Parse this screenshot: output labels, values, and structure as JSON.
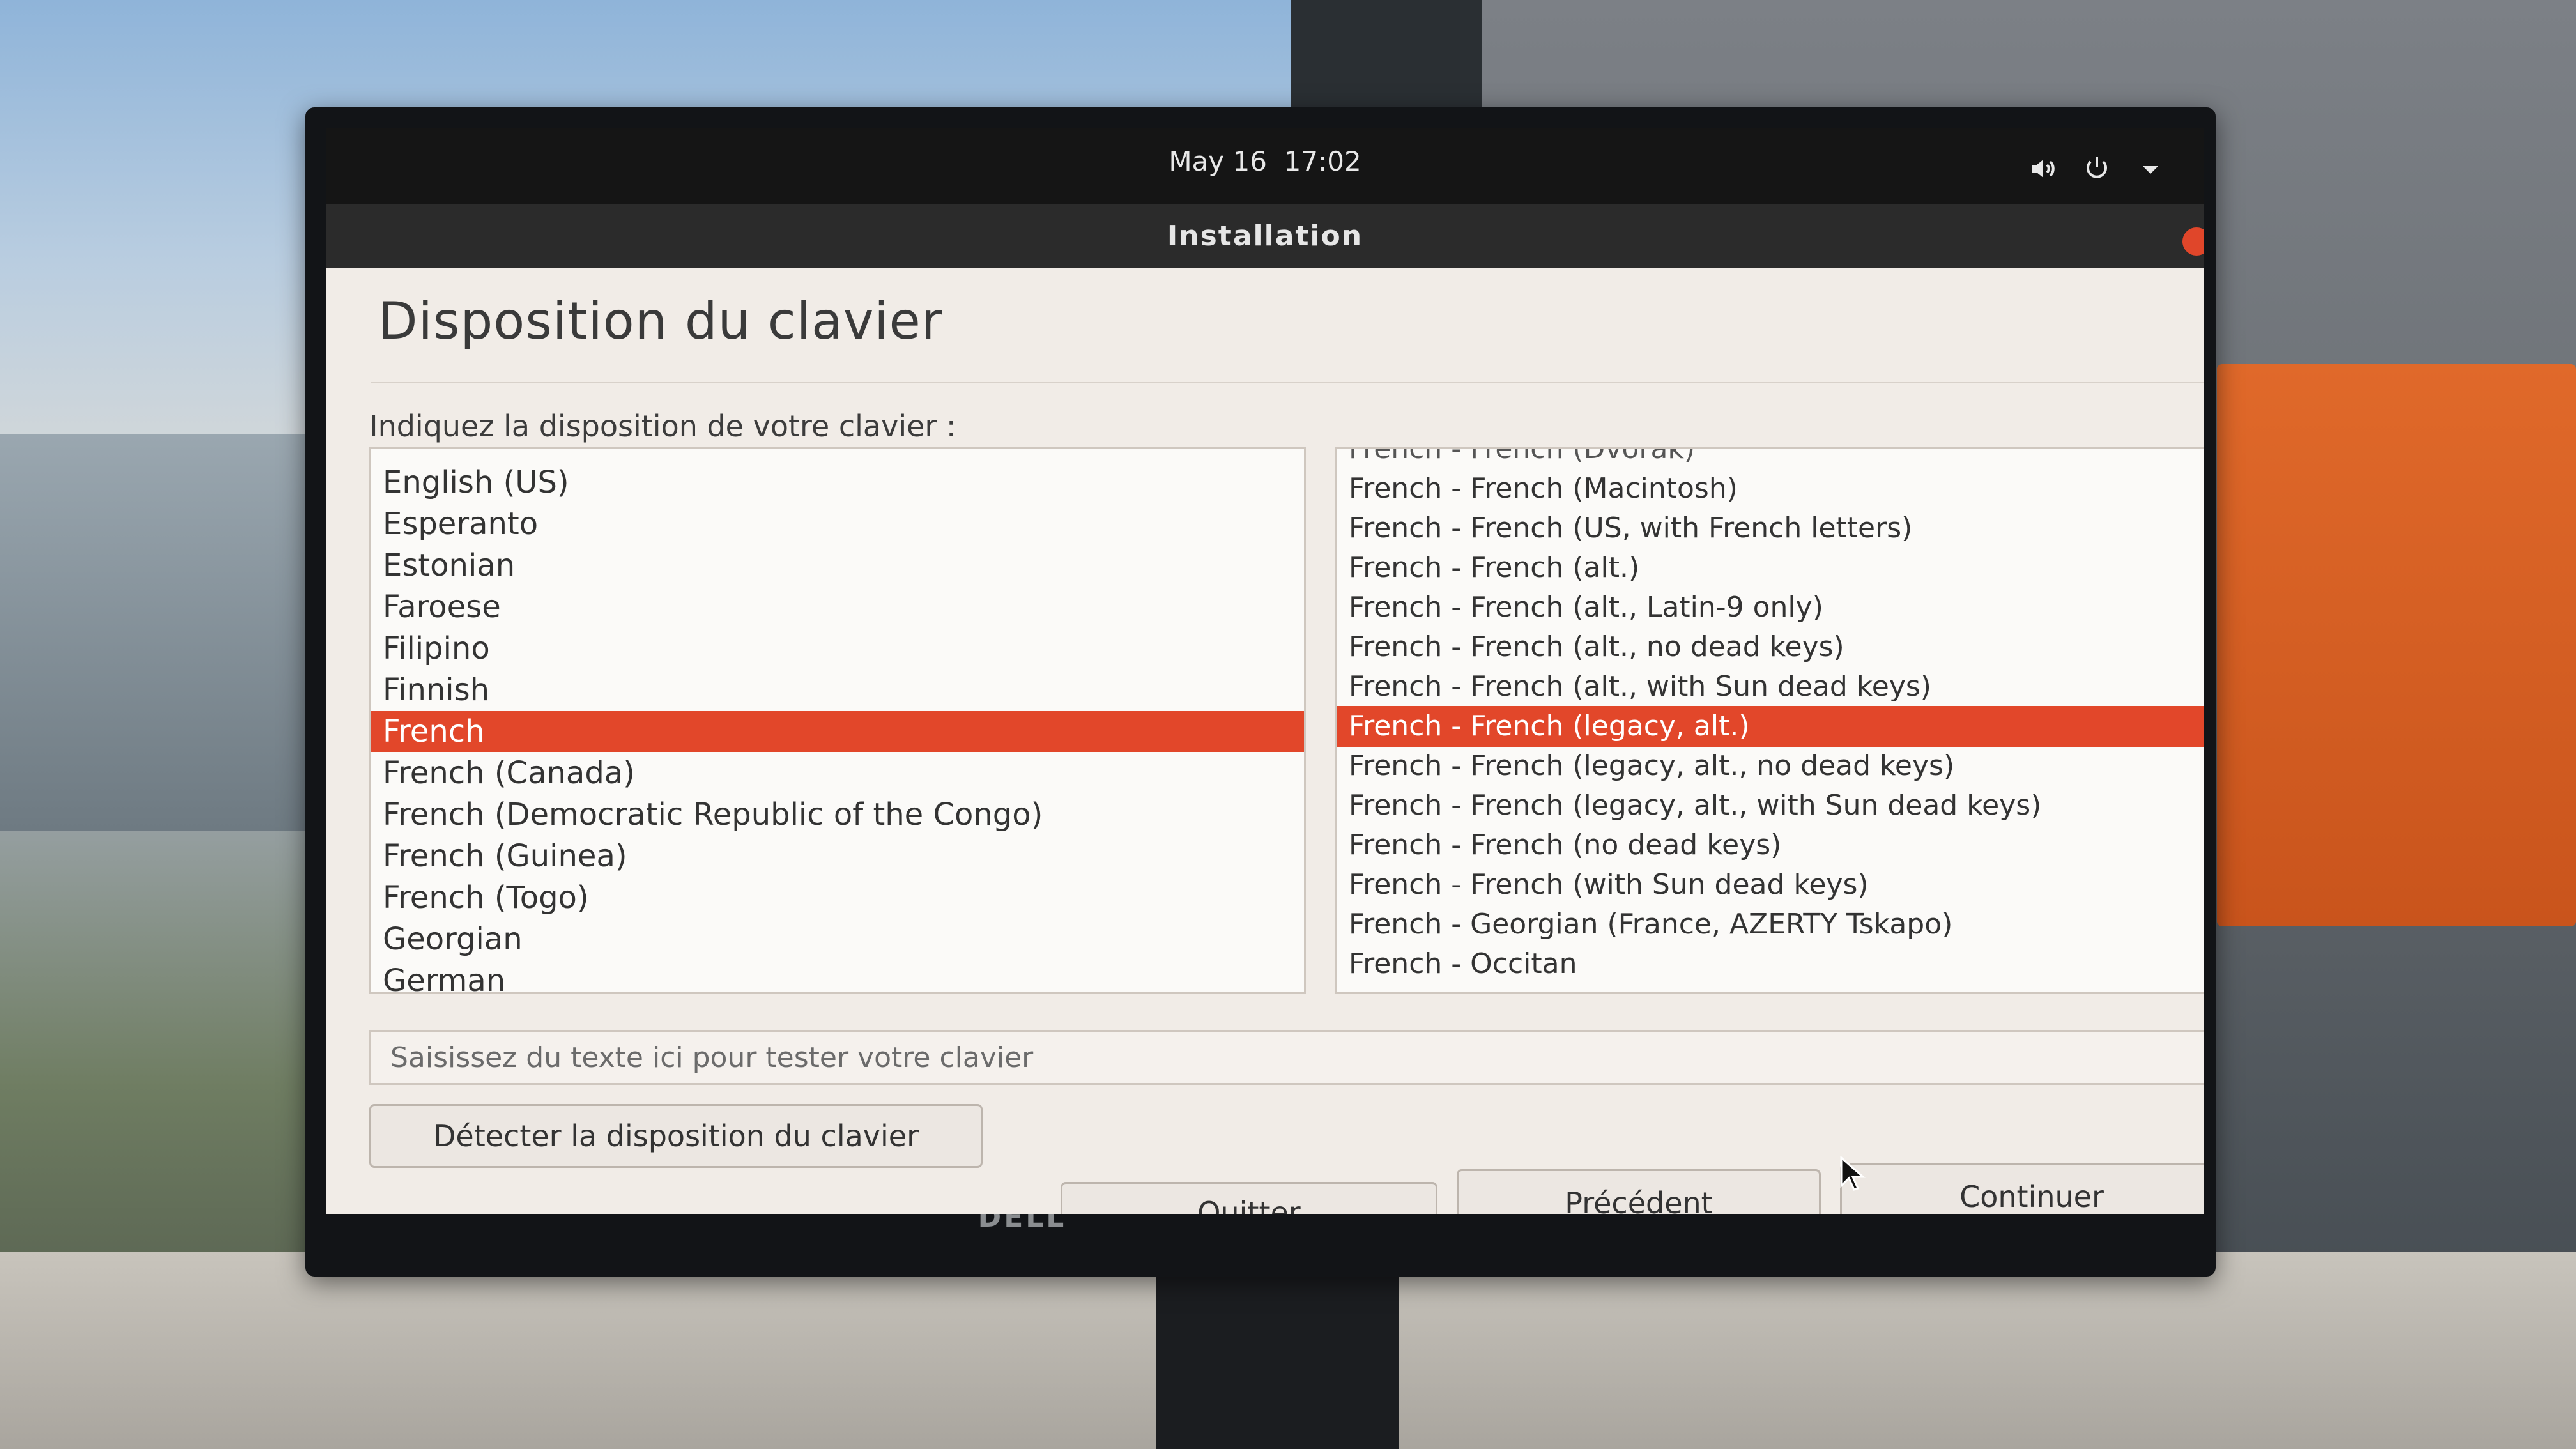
{
  "topbar": {
    "date": "May 16",
    "time": "17:02"
  },
  "window": {
    "title": "Installation"
  },
  "page": {
    "title": "Disposition du clavier",
    "prompt": "Indiquez la disposition de votre clavier :"
  },
  "layouts": {
    "items": [
      "English (US)",
      "Esperanto",
      "Estonian",
      "Faroese",
      "Filipino",
      "Finnish",
      "French",
      "French (Canada)",
      "French (Democratic Republic of the Congo)",
      "French (Guinea)",
      "French (Togo)",
      "Georgian",
      "German"
    ],
    "selected": "French"
  },
  "variants": {
    "partial_top": "French - French (Dvorak)",
    "items": [
      "French - French (Macintosh)",
      "French - French (US, with French letters)",
      "French - French (alt.)",
      "French - French (alt., Latin-9 only)",
      "French - French (alt., no dead keys)",
      "French - French (alt., with Sun dead keys)",
      "French - French (legacy, alt.)",
      "French - French (legacy, alt., no dead keys)",
      "French - French (legacy, alt., with Sun dead keys)",
      "French - French (no dead keys)",
      "French - French (with Sun dead keys)",
      "French - Georgian (France, AZERTY Tskapo)",
      "French - Occitan"
    ],
    "selected": "French - French (legacy, alt.)"
  },
  "test_field": {
    "placeholder": "Saisissez du texte ici pour tester votre clavier",
    "value": ""
  },
  "buttons": {
    "detect": "Détecter la disposition du clavier",
    "quit": "Quitter",
    "previous": "Précédent",
    "continue": "Continuer"
  },
  "monitor": {
    "brand": "DELL"
  },
  "icons": {
    "volume": "volume-icon",
    "power": "power-icon",
    "menu": "chevron-down-icon",
    "close": "close-icon"
  },
  "colors": {
    "selection": "#e2472a",
    "topbar": "#151515",
    "titlebar": "#2b2b2b",
    "window_bg": "#f1ece7"
  }
}
